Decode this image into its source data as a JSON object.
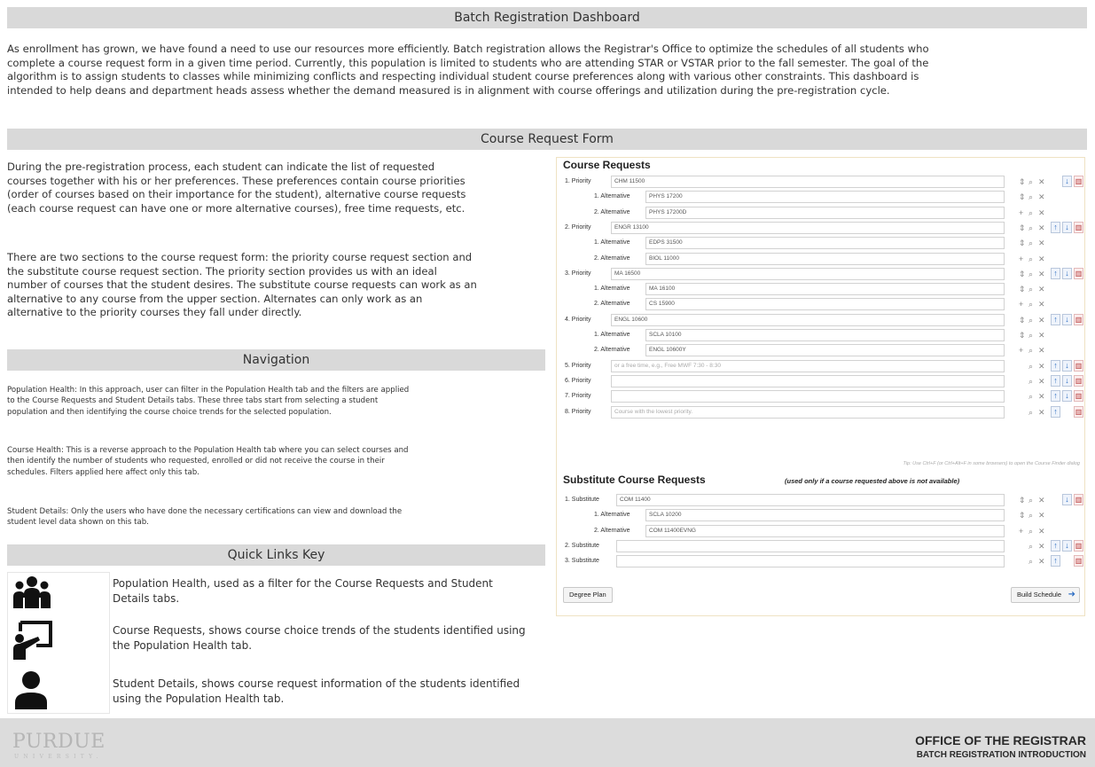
{
  "header": {
    "title": "Batch Registration Dashboard"
  },
  "intro": {
    "lines": [
      "As enrollment has grown, we have found a need to use our resources more efficiently. Batch registration allows the Registrar's Office to optimize the schedules of all students who",
      "complete a course request form in a given time period. Currently, this population is limited to students who are attending STAR or VSTAR prior to the fall semester. The goal of the",
      "algorithm is to assign students to classes while minimizing conflicts and respecting individual student course preferences along with various other constraints. This dashboard is",
      "intended to help deans and department heads assess whether the demand measured is in alignment with course offerings and utilization during the pre-registration cycle."
    ]
  },
  "crf_section": {
    "title": "Course Request Form",
    "para1": [
      "During the pre-registration process, each student can indicate the list of requested",
      "courses together with his or her preferences. These preferences contain course priorities",
      "(order of courses based on their importance for the student), alternative course requests",
      "(each course request can have one or more alternative courses), free time requests, etc."
    ],
    "para2": [
      "There are two sections to the course request form: the priority course request section and",
      "the substitute course request section. The priority section provides us with an ideal",
      "number of courses that the student desires. The substitute course requests can work as an",
      "alternative to any course from the upper section. Alternates can only work as an",
      "alternative to the priority courses they fall under directly."
    ]
  },
  "navigation": {
    "title": "Navigation",
    "p1": [
      "Population Health: In this approach, user can filter in the Population Health tab and the filters are  applied",
      "to the Course Requests and Student Details tabs. These three tabs start from selecting a student",
      "population and then identifying the course choice trends for the selected population."
    ],
    "p2": [
      "Course Health: This is a reverse approach to the Population Health tab where you can select courses and",
      "then identify the number of students who requested, enrolled or did not receive the course in their",
      "schedules. Filters applied here affect only this tab."
    ],
    "p3": [
      "Student Details: Only the users who have done the necessary certifications can view and download the",
      "student level data shown on this tab."
    ]
  },
  "quick_links": {
    "title": "Quick Links Key",
    "items": [
      {
        "icon": "population-group-icon",
        "lines": [
          "Population Health, used as a filter for the Course Requests and Student",
          "Details tabs."
        ]
      },
      {
        "icon": "presenter-board-icon",
        "lines": [
          "Course Requests, shows course choice trends of the students identified using",
          "the Population Health tab."
        ]
      },
      {
        "icon": "person-icon",
        "lines": [
          "Student Details, shows course request information of the students identified",
          "using the Population Health tab."
        ]
      }
    ]
  },
  "form": {
    "course_requests_title": "Course Requests",
    "rows": [
      {
        "label": "1. Priority",
        "value": "CHM 11500",
        "alt": false
      },
      {
        "label": "1. Alternative",
        "value": "PHYS 17200",
        "alt": true
      },
      {
        "label": "2. Alternative",
        "value": "PHYS 17200D",
        "alt": true
      },
      {
        "label": "2. Priority",
        "value": "ENGR 13100",
        "alt": false
      },
      {
        "label": "1. Alternative",
        "value": "EDPS 31500",
        "alt": true
      },
      {
        "label": "2. Alternative",
        "value": "BIOL 11000",
        "alt": true
      },
      {
        "label": "3. Priority",
        "value": "MA 16500",
        "alt": false
      },
      {
        "label": "1. Alternative",
        "value": "MA 16100",
        "alt": true
      },
      {
        "label": "2. Alternative",
        "value": "CS 15900",
        "alt": true
      },
      {
        "label": "4. Priority",
        "value": "ENGL 10600",
        "alt": false
      },
      {
        "label": "1. Alternative",
        "value": "SCLA 10100",
        "alt": true
      },
      {
        "label": "2. Alternative",
        "value": "ENGL 10600Y",
        "alt": true
      },
      {
        "label": "5. Priority",
        "placeholder": "or a free time, e.g., Free MWF 7:30 - 8:30",
        "alt": false
      },
      {
        "label": "6. Priority",
        "value": "",
        "alt": false
      },
      {
        "label": "7. Priority",
        "value": "",
        "alt": false
      },
      {
        "label": "8. Priority",
        "placeholder": "Course with the lowest priority.",
        "alt": false
      }
    ],
    "tip": "Tip: Use Ctrl+F (or Ctrl+Alt+F in some browsers) to open the Course Finder dialog",
    "substitute_title": "Substitute Course Requests",
    "substitute_note": "(used only if a course requested above is not available)",
    "sub_rows": [
      {
        "label": "1. Substitute",
        "value": "COM 11400",
        "alt": false
      },
      {
        "label": "1. Alternative",
        "value": "SCLA 10200",
        "alt": true
      },
      {
        "label": "2. Alternative",
        "value": "COM 11400EVNG",
        "alt": true
      },
      {
        "label": "2. Substitute",
        "value": "",
        "alt": false
      },
      {
        "label": "3. Substitute",
        "value": "",
        "alt": false
      }
    ],
    "degree_plan_label": "Degree Plan",
    "build_schedule_label": "Build Schedule"
  },
  "footer": {
    "logo_main": "PURDUE",
    "logo_sub": "UNIVERSITY.",
    "title": "OFFICE OF THE REGISTRAR",
    "subtitle": "BATCH REGISTRATION INTRODUCTION"
  },
  "colors": {
    "band": "#d9d9d9",
    "form_border": "#efe2c3",
    "arrow_blue": "#2f6fc3",
    "trash_red": "#b73a3a",
    "footer": "#dcdcdc"
  }
}
